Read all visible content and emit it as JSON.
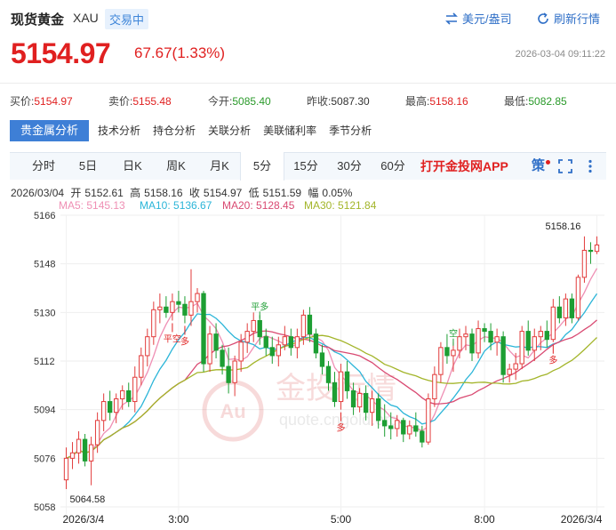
{
  "header": {
    "title": "现货黄金",
    "code": "XAU",
    "status": "交易中",
    "currency_btn": "美元/盎司",
    "refresh_btn": "刷新行情"
  },
  "price": {
    "last": "5154.97",
    "change": "67.67(1.33%)",
    "datetime": "2026-03-04 09:11:22"
  },
  "quotes": [
    {
      "label": "买价:",
      "value": "5154.97",
      "color": "red"
    },
    {
      "label": "卖价:",
      "value": "5155.48",
      "color": "red"
    },
    {
      "label": "今开:",
      "value": "5085.40",
      "color": "green"
    },
    {
      "label": "昨收:",
      "value": "5087.30",
      "color": "plain"
    },
    {
      "label": "最高:",
      "value": "5158.16",
      "color": "red"
    },
    {
      "label": "最低:",
      "value": "5082.85",
      "color": "green"
    }
  ],
  "analysis_tabs": [
    "贵金属分析",
    "技术分析",
    "持仓分析",
    "关联分析",
    "美联储利率",
    "季节分析"
  ],
  "period_tabs": [
    "分时",
    "5日",
    "日K",
    "周K",
    "月K",
    "5分",
    "15分",
    "30分",
    "60分"
  ],
  "active_period": "5分",
  "app_link": "打开金投网APP",
  "policy_icon": "策",
  "ohlc": {
    "date": "2026/03/04",
    "open_label": "开",
    "open": "5152.61",
    "high_label": "高",
    "high": "5158.16",
    "close_label": "收",
    "close": "5154.97",
    "low_label": "低",
    "low": "5151.59",
    "amp_label": "幅",
    "amp": "0.05%"
  },
  "ma_legend": [
    {
      "label": "MA5: 5145.13",
      "color": "#ef8fb4"
    },
    {
      "label": "MA10: 5136.67",
      "color": "#2bb5d8"
    },
    {
      "label": "MA20: 5128.45",
      "color": "#d94a72"
    },
    {
      "label": "MA30: 5121.84",
      "color": "#a3b52a"
    }
  ],
  "watermark": {
    "brand": "金投行情",
    "url": "quote.cngold.org"
  },
  "chart_data": {
    "type": "candlestick",
    "y_ticks": [
      "5166",
      "5148",
      "5130",
      "5112",
      "5094",
      "5076",
      "5058"
    ],
    "ylim": [
      5058,
      5166
    ],
    "x_tick_labels": [
      "2026/3/4",
      "3:00",
      "5:00",
      "8:00",
      "2026/3/4"
    ],
    "high_label": "5158.16",
    "low_label": "5064.58",
    "signals": [
      "多",
      "平空",
      "平多",
      "多",
      "空",
      "多"
    ],
    "candles_ohlc": [
      [
        5068,
        5080,
        5064.58,
        5076
      ],
      [
        5076,
        5082,
        5072,
        5078
      ],
      [
        5078,
        5086,
        5074,
        5083
      ],
      [
        5083,
        5085,
        5073,
        5075
      ],
      [
        5075,
        5084,
        5066,
        5081
      ],
      [
        5081,
        5093,
        5078,
        5090
      ],
      [
        5090,
        5100,
        5086,
        5097
      ],
      [
        5097,
        5101,
        5090,
        5093
      ],
      [
        5093,
        5100,
        5089,
        5098
      ],
      [
        5098,
        5103,
        5094,
        5101
      ],
      [
        5101,
        5104,
        5095,
        5097
      ],
      [
        5097,
        5110,
        5093,
        5106
      ],
      [
        5106,
        5117,
        5103,
        5114
      ],
      [
        5114,
        5124,
        5110,
        5121
      ],
      [
        5121,
        5134,
        5118,
        5131
      ],
      [
        5131,
        5137,
        5126,
        5132
      ],
      [
        5132,
        5136,
        5128,
        5130
      ],
      [
        5130,
        5137,
        5127,
        5134
      ],
      [
        5134,
        5138,
        5130,
        5133
      ],
      [
        5133,
        5136,
        5126,
        5129
      ],
      [
        5129,
        5146,
        5125,
        5134
      ],
      [
        5134,
        5139,
        5130,
        5137
      ],
      [
        5137,
        5138,
        5108,
        5111
      ],
      [
        5111,
        5125,
        5108,
        5122
      ],
      [
        5122,
        5126,
        5113,
        5116
      ],
      [
        5116,
        5118,
        5107,
        5110
      ],
      [
        5110,
        5117,
        5100,
        5104
      ],
      [
        5104,
        5114,
        5099,
        5112
      ],
      [
        5112,
        5122,
        5108,
        5119
      ],
      [
        5119,
        5126,
        5115,
        5123
      ],
      [
        5123,
        5130,
        5119,
        5127
      ],
      [
        5127,
        5129,
        5118,
        5121
      ],
      [
        5121,
        5124,
        5114,
        5117
      ],
      [
        5117,
        5121,
        5111,
        5114
      ],
      [
        5114,
        5121,
        5110,
        5118
      ],
      [
        5118,
        5125,
        5116,
        5121
      ],
      [
        5121,
        5124,
        5114,
        5117
      ],
      [
        5117,
        5124,
        5113,
        5121
      ],
      [
        5121,
        5131,
        5118,
        5129
      ],
      [
        5129,
        5132,
        5119,
        5122
      ],
      [
        5122,
        5124,
        5113,
        5115
      ],
      [
        5115,
        5118,
        5107,
        5110
      ],
      [
        5110,
        5112,
        5101,
        5104
      ],
      [
        5104,
        5108,
        5095,
        5097
      ],
      [
        5097,
        5111,
        5094,
        5108
      ],
      [
        5108,
        5112,
        5098,
        5101
      ],
      [
        5101,
        5104,
        5092,
        5095
      ],
      [
        5095,
        5102,
        5093,
        5100
      ],
      [
        5100,
        5103,
        5090,
        5093
      ],
      [
        5093,
        5101,
        5088,
        5098
      ],
      [
        5098,
        5100,
        5087,
        5090
      ],
      [
        5090,
        5096,
        5084,
        5088
      ],
      [
        5088,
        5093,
        5083,
        5087
      ],
      [
        5087,
        5092,
        5084,
        5090
      ],
      [
        5090,
        5091,
        5082,
        5085
      ],
      [
        5085,
        5090,
        5083,
        5088
      ],
      [
        5088,
        5093,
        5084,
        5086
      ],
      [
        5086,
        5088,
        5080,
        5082
      ],
      [
        5082,
        5100,
        5081,
        5098
      ],
      [
        5098,
        5110,
        5095,
        5107
      ],
      [
        5107,
        5119,
        5104,
        5117
      ],
      [
        5117,
        5122,
        5111,
        5114
      ],
      [
        5114,
        5119,
        5108,
        5116
      ],
      [
        5116,
        5124,
        5113,
        5121
      ],
      [
        5121,
        5125,
        5116,
        5122
      ],
      [
        5122,
        5124,
        5112,
        5115
      ],
      [
        5115,
        5127,
        5113,
        5124
      ],
      [
        5124,
        5126,
        5119,
        5123
      ],
      [
        5123,
        5126,
        5116,
        5119
      ],
      [
        5119,
        5124,
        5114,
        5121
      ],
      [
        5121,
        5123,
        5104,
        5107
      ],
      [
        5107,
        5111,
        5104,
        5109
      ],
      [
        5109,
        5115,
        5105,
        5111
      ],
      [
        5111,
        5125,
        5109,
        5123
      ],
      [
        5123,
        5127,
        5114,
        5116
      ],
      [
        5116,
        5124,
        5112,
        5121
      ],
      [
        5121,
        5125,
        5116,
        5123
      ],
      [
        5123,
        5127,
        5117,
        5120
      ],
      [
        5120,
        5135,
        5119,
        5132
      ],
      [
        5132,
        5136,
        5126,
        5128
      ],
      [
        5128,
        5137,
        5125,
        5135
      ],
      [
        5135,
        5137,
        5126,
        5128
      ],
      [
        5128,
        5144,
        5127,
        5143
      ],
      [
        5143,
        5158.16,
        5141,
        5153
      ],
      [
        5153,
        5156,
        5148,
        5152.6
      ],
      [
        5152.6,
        5158.16,
        5151.59,
        5154.97
      ]
    ]
  }
}
